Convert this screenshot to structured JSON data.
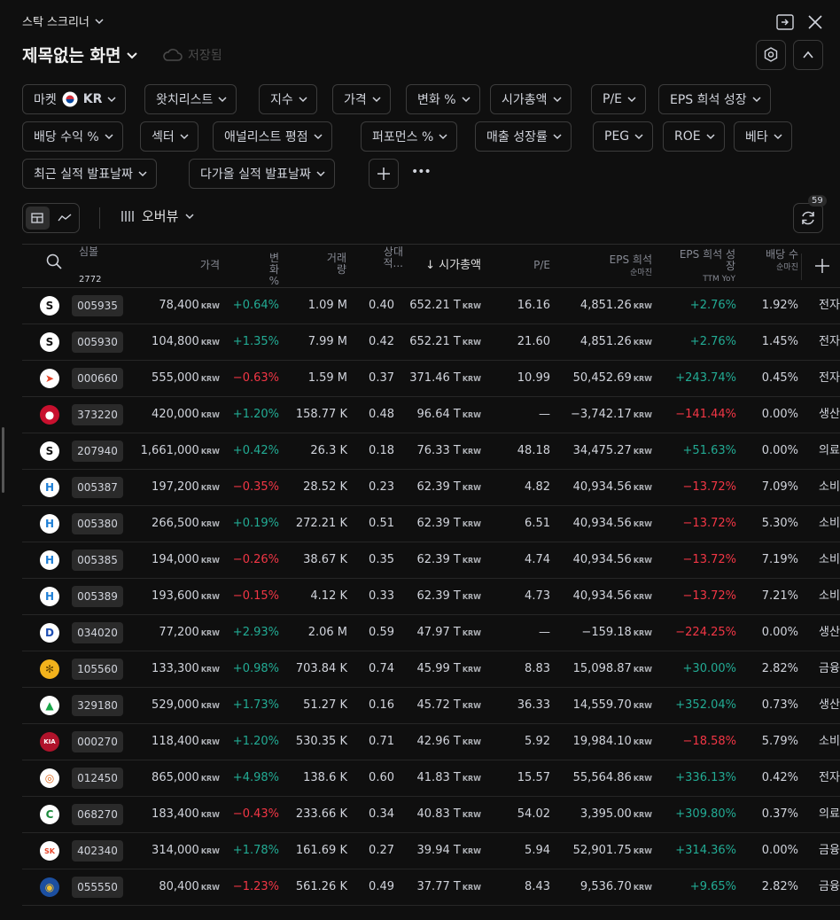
{
  "app": {
    "title": "스탁 스크리너"
  },
  "screen": {
    "title": "제목없는 화면",
    "save_label": "저장됨"
  },
  "filters": [
    {
      "label": "마켓",
      "value": "KR",
      "flag": true
    },
    {
      "label": "왓치리스트"
    },
    {
      "label": "지수"
    },
    {
      "label": "가격"
    },
    {
      "label": "변화 %"
    },
    {
      "label": "시가총액"
    },
    {
      "label": "P/E"
    },
    {
      "label": "EPS 희석 성장"
    },
    {
      "label": "배당 수익 %"
    },
    {
      "label": "섹터"
    },
    {
      "label": "애널리스트 평점"
    },
    {
      "label": "퍼포먼스 %"
    },
    {
      "label": "매출 성장률"
    },
    {
      "label": "PEG"
    },
    {
      "label": "ROE"
    },
    {
      "label": "베타"
    },
    {
      "label": "최근 실적 발표날짜"
    },
    {
      "label": "다가올 실적 발표날짜"
    }
  ],
  "more_label": "•••",
  "view": {
    "label": "오버뷰",
    "refresh_count": "59"
  },
  "columns": {
    "symbol": "심볼",
    "symbol_count": "2772",
    "price": "가격",
    "change": "변화 %",
    "volume": "거래량",
    "relvol": "상대적...",
    "mcap": "↓ 시가총액",
    "pe": "P/E",
    "eps": "EPS 희석",
    "eps_sub": "순마진",
    "epsg": "EPS 희석 성장",
    "epsg_sub": "TTM YoY",
    "div": "배당 수",
    "div_sub": "순마진"
  },
  "unit": "KRW",
  "rows": [
    {
      "logo": "S",
      "logo_bg": "#ffffff",
      "logo_fg": "#111111",
      "ticker": "005935",
      "price": "78,400",
      "change": "+0.64%",
      "change_dir": "pos",
      "volume": "1.09 M",
      "relvol": "0.40",
      "mcap": "652.21 T",
      "pe": "16.16",
      "eps": "4,851.26",
      "epsg": "+2.76%",
      "epsg_dir": "pos",
      "div": "1.92%",
      "sector": "전자"
    },
    {
      "logo": "S",
      "logo_bg": "#ffffff",
      "logo_fg": "#111111",
      "ticker": "005930",
      "price": "104,800",
      "change": "+1.35%",
      "change_dir": "pos",
      "volume": "7.99 M",
      "relvol": "0.42",
      "mcap": "652.21 T",
      "pe": "21.60",
      "eps": "4,851.26",
      "epsg": "+2.76%",
      "epsg_dir": "pos",
      "div": "1.45%",
      "sector": "전자"
    },
    {
      "logo": "➤",
      "logo_bg": "#ffffff",
      "logo_fg": "#e8452a",
      "ticker": "000660",
      "price": "555,000",
      "change": "−0.63%",
      "change_dir": "neg",
      "volume": "1.59 M",
      "relvol": "0.37",
      "mcap": "371.46 T",
      "pe": "10.99",
      "eps": "50,452.69",
      "epsg": "+243.74%",
      "epsg_dir": "pos",
      "div": "0.45%",
      "sector": "전자"
    },
    {
      "logo": "●",
      "logo_bg": "#c8102e",
      "logo_fg": "#ffffff",
      "ticker": "373220",
      "price": "420,000",
      "change": "+1.20%",
      "change_dir": "pos",
      "volume": "158.77 K",
      "relvol": "0.48",
      "mcap": "96.64 T",
      "pe": "—",
      "eps": "−3,742.17",
      "epsg": "−141.44%",
      "epsg_dir": "neg",
      "div": "0.00%",
      "sector": "생산"
    },
    {
      "logo": "S",
      "logo_bg": "#ffffff",
      "logo_fg": "#111111",
      "ticker": "207940",
      "price": "1,661,000",
      "change": "+0.42%",
      "change_dir": "pos",
      "volume": "26.3 K",
      "relvol": "0.18",
      "mcap": "76.33 T",
      "pe": "48.18",
      "eps": "34,475.27",
      "epsg": "+51.63%",
      "epsg_dir": "pos",
      "div": "0.00%",
      "sector": "의료"
    },
    {
      "logo": "H",
      "logo_bg": "#ffffff",
      "logo_fg": "#1e7fd6",
      "ticker": "005387",
      "price": "197,200",
      "change": "−0.35%",
      "change_dir": "neg",
      "volume": "28.52 K",
      "relvol": "0.23",
      "mcap": "62.39 T",
      "pe": "4.82",
      "eps": "40,934.56",
      "epsg": "−13.72%",
      "epsg_dir": "neg",
      "div": "7.09%",
      "sector": "소비"
    },
    {
      "logo": "H",
      "logo_bg": "#ffffff",
      "logo_fg": "#1e7fd6",
      "ticker": "005380",
      "price": "266,500",
      "change": "+0.19%",
      "change_dir": "pos",
      "volume": "272.21 K",
      "relvol": "0.51",
      "mcap": "62.39 T",
      "pe": "6.51",
      "eps": "40,934.56",
      "epsg": "−13.72%",
      "epsg_dir": "neg",
      "div": "5.30%",
      "sector": "소비"
    },
    {
      "logo": "H",
      "logo_bg": "#ffffff",
      "logo_fg": "#1e7fd6",
      "ticker": "005385",
      "price": "194,000",
      "change": "−0.26%",
      "change_dir": "neg",
      "volume": "38.67 K",
      "relvol": "0.35",
      "mcap": "62.39 T",
      "pe": "4.74",
      "eps": "40,934.56",
      "epsg": "−13.72%",
      "epsg_dir": "neg",
      "div": "7.19%",
      "sector": "소비"
    },
    {
      "logo": "H",
      "logo_bg": "#ffffff",
      "logo_fg": "#1e7fd6",
      "ticker": "005389",
      "price": "193,600",
      "change": "−0.15%",
      "change_dir": "neg",
      "volume": "4.12 K",
      "relvol": "0.33",
      "mcap": "62.39 T",
      "pe": "4.73",
      "eps": "40,934.56",
      "epsg": "−13.72%",
      "epsg_dir": "neg",
      "div": "7.21%",
      "sector": "소비"
    },
    {
      "logo": "D",
      "logo_bg": "#ffffff",
      "logo_fg": "#1f4fb4",
      "ticker": "034020",
      "price": "77,200",
      "change": "+2.93%",
      "change_dir": "pos",
      "volume": "2.06 M",
      "relvol": "0.59",
      "mcap": "47.97 T",
      "pe": "—",
      "eps": "−159.18",
      "epsg": "−224.25%",
      "epsg_dir": "neg",
      "div": "0.00%",
      "sector": "생산"
    },
    {
      "logo": "✻",
      "logo_bg": "#f2b21c",
      "logo_fg": "#6b4a00",
      "ticker": "105560",
      "price": "133,300",
      "change": "+0.98%",
      "change_dir": "pos",
      "volume": "703.84 K",
      "relvol": "0.74",
      "mcap": "45.99 T",
      "pe": "8.83",
      "eps": "15,098.87",
      "epsg": "+30.00%",
      "epsg_dir": "pos",
      "div": "2.82%",
      "sector": "금융"
    },
    {
      "logo": "▲",
      "logo_bg": "#ffffff",
      "logo_fg": "#1aa64a",
      "ticker": "329180",
      "price": "529,000",
      "change": "+1.73%",
      "change_dir": "pos",
      "volume": "51.27 K",
      "relvol": "0.16",
      "mcap": "45.72 T",
      "pe": "36.33",
      "eps": "14,559.70",
      "epsg": "+352.04%",
      "epsg_dir": "pos",
      "div": "0.73%",
      "sector": "생산"
    },
    {
      "logo": "KIA",
      "logo_bg": "#b0132b",
      "logo_fg": "#ffffff",
      "ticker": "000270",
      "price": "118,400",
      "change": "+1.20%",
      "change_dir": "pos",
      "volume": "530.35 K",
      "relvol": "0.71",
      "mcap": "42.96 T",
      "pe": "5.92",
      "eps": "19,984.10",
      "epsg": "−18.58%",
      "epsg_dir": "neg",
      "div": "5.79%",
      "sector": "소비"
    },
    {
      "logo": "◎",
      "logo_bg": "#ffffff",
      "logo_fg": "#e06a1c",
      "ticker": "012450",
      "price": "865,000",
      "change": "+4.98%",
      "change_dir": "pos",
      "volume": "138.6 K",
      "relvol": "0.60",
      "mcap": "41.83 T",
      "pe": "15.57",
      "eps": "55,564.86",
      "epsg": "+336.13%",
      "epsg_dir": "pos",
      "div": "0.42%",
      "sector": "전자"
    },
    {
      "logo": "C",
      "logo_bg": "#ffffff",
      "logo_fg": "#1a8a3c",
      "ticker": "068270",
      "price": "183,400",
      "change": "−0.43%",
      "change_dir": "neg",
      "volume": "233.66 K",
      "relvol": "0.34",
      "mcap": "40.83 T",
      "pe": "54.02",
      "eps": "3,395.00",
      "epsg": "+309.80%",
      "epsg_dir": "pos",
      "div": "0.37%",
      "sector": "의료"
    },
    {
      "logo": "SK",
      "logo_bg": "#ffffff",
      "logo_fg": "#e8452a",
      "ticker": "402340",
      "price": "314,000",
      "change": "+1.78%",
      "change_dir": "pos",
      "volume": "161.69 K",
      "relvol": "0.27",
      "mcap": "39.94 T",
      "pe": "5.94",
      "eps": "52,901.75",
      "epsg": "+314.36%",
      "epsg_dir": "pos",
      "div": "0.00%",
      "sector": "금융"
    },
    {
      "logo": "◉",
      "logo_bg": "#1c4fa0",
      "logo_fg": "#f2c12e",
      "ticker": "055550",
      "price": "80,400",
      "change": "−1.23%",
      "change_dir": "neg",
      "volume": "561.26 K",
      "relvol": "0.49",
      "mcap": "37.77 T",
      "pe": "8.43",
      "eps": "9,536.70",
      "epsg": "+9.65%",
      "epsg_dir": "pos",
      "div": "2.82%",
      "sector": "금융"
    }
  ]
}
